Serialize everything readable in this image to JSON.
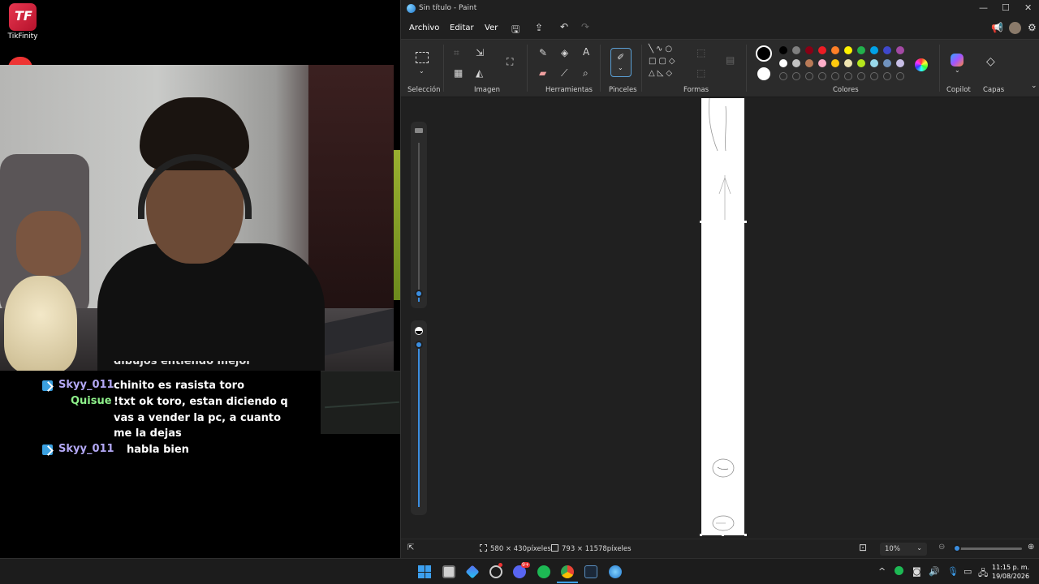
{
  "stream": {
    "tikfinity_label": "TikFinity",
    "tikfinity_logo": "TF"
  },
  "chat": {
    "partial_top": "dibujos entiendo mejor",
    "messages": [
      {
        "user": "Skyy_011",
        "user_color": "#b3a8f5",
        "badge": true,
        "text": "chinito es rasista toro"
      },
      {
        "user": "Quisue",
        "user_color": "#8ef08a",
        "badge": false,
        "text": "!txt ok toro, estan diciendo q vas a vender la pc, a cuanto me la dejas"
      },
      {
        "user": "Skyy_011",
        "user_color": "#b3a8f5",
        "badge": true,
        "text": "habla bien"
      }
    ]
  },
  "paint": {
    "window_title": "Sin título - Paint",
    "menu": [
      "Archivo",
      "Editar",
      "Ver"
    ],
    "groups": {
      "seleccion": "Selección",
      "imagen": "Imagen",
      "herramientas": "Herramientas",
      "pinceles": "Pinceles",
      "formas": "Formas",
      "colores": "Colores",
      "copilot": "Copilot",
      "capas": "Capas"
    },
    "palette_row1": [
      "#000000",
      "#7f7f7f",
      "#880015",
      "#ed1c24",
      "#ff7f27",
      "#fff200",
      "#22b14c",
      "#00a2e8",
      "#3f48cc",
      "#a349a4"
    ],
    "palette_row2": [
      "#ffffff",
      "#c3c3c3",
      "#b97a57",
      "#ffaec9",
      "#ffc90e",
      "#efe4b0",
      "#b5e61d",
      "#99d9ea",
      "#7092be",
      "#c8bfe7"
    ],
    "primary_color": "#000000",
    "secondary_color": "#ffffff",
    "status": {
      "selection_size": "580 × 430píxeles",
      "canvas_size": "793 × 11578píxeles",
      "zoom": "10%"
    },
    "brush_size_level": 0.05,
    "opacity_level": 1.0
  },
  "taskbar": {
    "time": "11:15 p. m.",
    "date": "19/08/2026",
    "discord_badge": "9+"
  }
}
